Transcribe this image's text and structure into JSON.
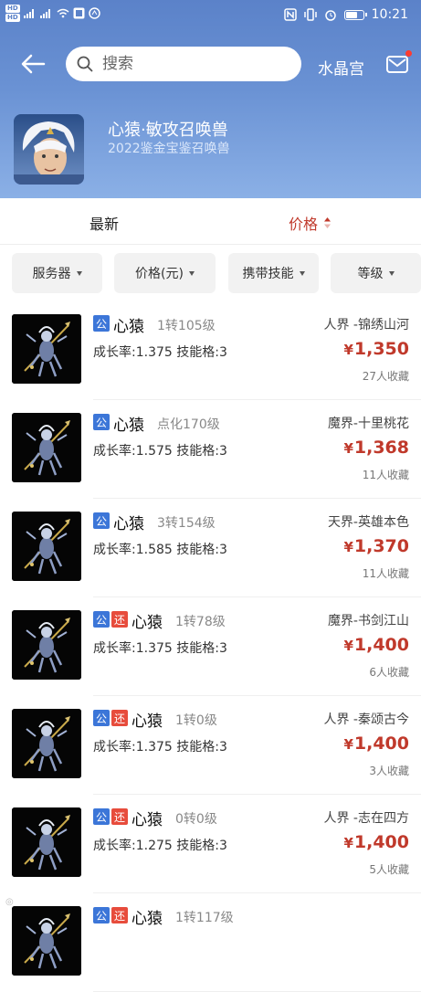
{
  "status_bar": {
    "time": "10:21"
  },
  "header": {
    "search_placeholder": "搜索",
    "server_name": "水晶宫"
  },
  "pet": {
    "title": "心猿·敏攻召唤兽",
    "subtitle": "2022鉴金宝鉴召唤兽"
  },
  "sort": {
    "latest": "最新",
    "price": "价格"
  },
  "filters": [
    "服务器",
    "价格(元)",
    "携带技能",
    "等级"
  ],
  "items": [
    {
      "tags": [
        "公"
      ],
      "name": "心猿",
      "level": "1转105级",
      "stats": "成长率:1.375 技能格:3",
      "server": "人界 -锦绣山河",
      "price": "1,350",
      "fav": "27人收藏"
    },
    {
      "tags": [
        "公"
      ],
      "name": "心猿",
      "level": "点化170级",
      "stats": "成长率:1.575 技能格:3",
      "server": "魔界-十里桃花",
      "price": "1,368",
      "fav": "11人收藏"
    },
    {
      "tags": [
        "公"
      ],
      "name": "心猿",
      "level": "3转154级",
      "stats": "成长率:1.585 技能格:3",
      "server": "天界-英雄本色",
      "price": "1,370",
      "fav": "11人收藏"
    },
    {
      "tags": [
        "公",
        "还"
      ],
      "name": "心猿",
      "level": "1转78级",
      "stats": "成长率:1.375 技能格:3",
      "server": "魔界-书剑江山",
      "price": "1,400",
      "fav": "6人收藏"
    },
    {
      "tags": [
        "公",
        "还"
      ],
      "name": "心猿",
      "level": "1转0级",
      "stats": "成长率:1.375 技能格:3",
      "server": "人界 -秦颂古今",
      "price": "1,400",
      "fav": "3人收藏"
    },
    {
      "tags": [
        "公",
        "还"
      ],
      "name": "心猿",
      "level": "0转0级",
      "stats": "成长率:1.275 技能格:3",
      "server": "人界 -志在四方",
      "price": "1,400",
      "fav": "5人收藏"
    },
    {
      "tags": [
        "公",
        "还"
      ],
      "name": "心猿",
      "level": "1转117级",
      "stats": "",
      "server": "",
      "price": "",
      "fav": ""
    }
  ],
  "currency_symbol": "¥",
  "colors": {
    "accent_red": "#c0392b",
    "tag_blue": "#3c76d8",
    "tag_red": "#e74c3c",
    "header_blue": "#5b82c9"
  },
  "icons": [
    "back-arrow-icon",
    "search-icon",
    "mail-icon",
    "sort-arrows-icon",
    "dropdown-triangle-icon"
  ]
}
